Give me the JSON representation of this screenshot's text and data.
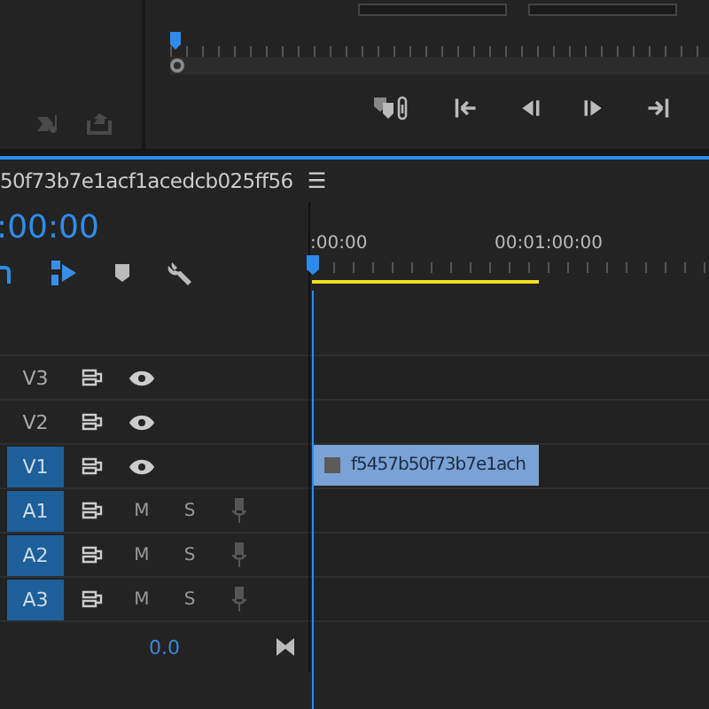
{
  "timeline": {
    "sequence_name": "50f73b7e1acf1acedcb025ff56",
    "menu": "☰",
    "timecode": ":00:00",
    "ruler_labels": [
      ":00:00",
      "00:01:00:00"
    ],
    "work_area": {
      "level": 0.57
    },
    "tracks": [
      {
        "name": "V3",
        "kind": "video",
        "selected": false
      },
      {
        "name": "V2",
        "kind": "video",
        "selected": false
      },
      {
        "name": "V1",
        "kind": "video",
        "selected": true,
        "clip": "f5457b50f73b7e1ach"
      },
      {
        "name": "A1",
        "kind": "audio",
        "selected": true,
        "mute": "M",
        "solo": "S"
      },
      {
        "name": "A2",
        "kind": "audio",
        "selected": true,
        "mute": "M",
        "solo": "S"
      },
      {
        "name": "A3",
        "kind": "audio",
        "selected": true,
        "mute": "M",
        "solo": "S"
      }
    ],
    "master_volume": "0.0"
  }
}
